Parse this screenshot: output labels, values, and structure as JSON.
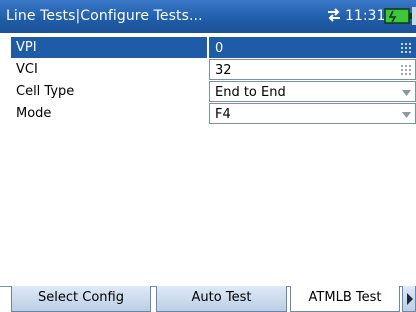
{
  "titlebar": {
    "title": "Line Tests|Configure Tests...",
    "time": "11:31",
    "sync_icon": "transfer-arrows-icon",
    "battery_icon": "battery-icon"
  },
  "params": [
    {
      "label": "VPI",
      "value": "0",
      "control": "keypad",
      "selected": true
    },
    {
      "label": "VCI",
      "value": "32",
      "control": "keypad",
      "selected": false
    },
    {
      "label": "Cell Type",
      "value": "End to End",
      "control": "dropdown",
      "selected": false
    },
    {
      "label": "Mode",
      "value": "F4",
      "control": "dropdown",
      "selected": false
    }
  ],
  "tabs": [
    {
      "label": "Select Config",
      "active": false
    },
    {
      "label": "Auto Test",
      "active": false
    },
    {
      "label": "ATMLB Test",
      "active": true
    }
  ],
  "colors": {
    "accent": "#1f5ca8",
    "battery_green": "#3fc63a"
  }
}
